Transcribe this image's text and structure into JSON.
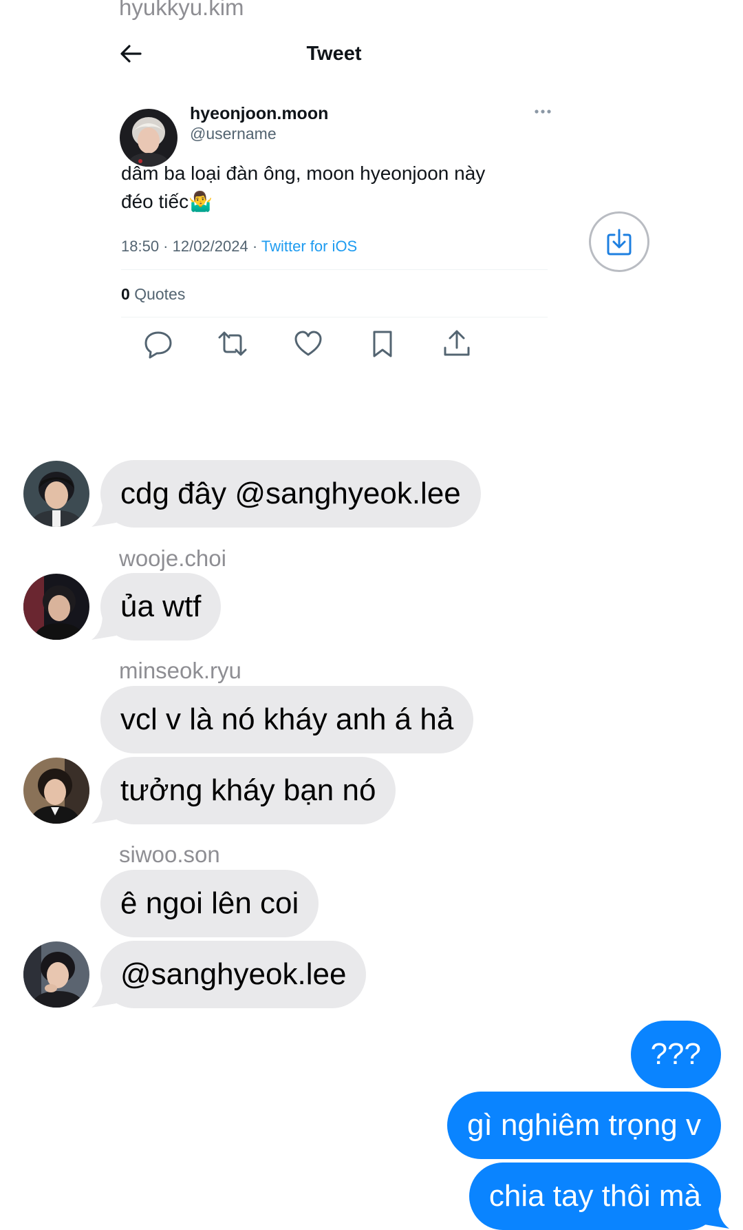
{
  "top_sender": "hyukkyu.kim",
  "tweet": {
    "header_title": "Tweet",
    "display_name": "hyeonjoon.moon",
    "handle": "@username",
    "text_line1": "dâm ba loại đàn ông, moon hyeonjoon này",
    "text_line2": "đéo tiếc",
    "emoji": "🤷‍♂️",
    "timestamp": "18:50 · 12/02/2024 · ",
    "source": "Twitter for iOS",
    "quotes_count": "0",
    "quotes_label": "Quotes"
  },
  "messages": [
    {
      "sender": "",
      "text": "cdg đây @sanghyeok.lee"
    },
    {
      "sender": "wooje.choi",
      "text": "ủa wtf"
    },
    {
      "sender": "minseok.ryu",
      "text": "vcl v là nó kháy anh á hả"
    },
    {
      "sender": "",
      "text": "tưởng kháy bạn nó"
    },
    {
      "sender": "siwoo.son",
      "text": "ê ngoi lên coi"
    },
    {
      "sender": "",
      "text": "@sanghyeok.lee"
    }
  ],
  "outgoing": [
    {
      "text": "???"
    },
    {
      "text": "gì nghiêm trọng v"
    },
    {
      "text": "chia tay thôi mà"
    }
  ],
  "colors": {
    "incoming_bubble": "#e9e9eb",
    "outgoing_bubble": "#0a84ff",
    "twitter_blue": "#1d9bf0",
    "sender_gray": "#8e8e93"
  }
}
